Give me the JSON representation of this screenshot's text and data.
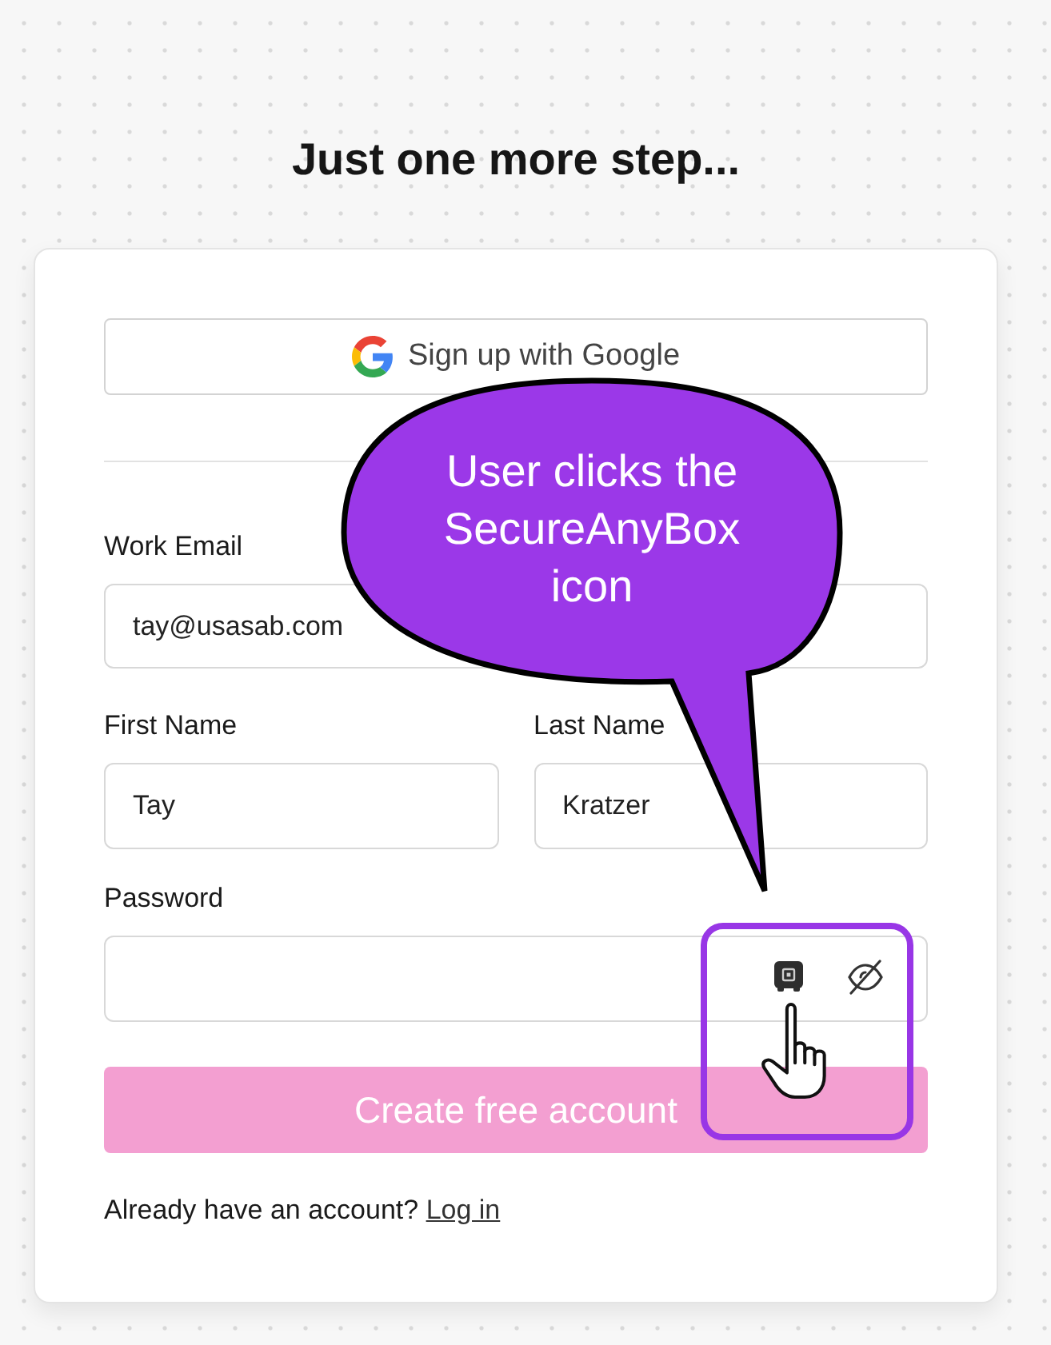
{
  "heading": "Just one more step...",
  "google_button": {
    "label": "Sign up with Google"
  },
  "work_email": {
    "label": "Work Email",
    "value": "tay@usasab.com"
  },
  "name_fields": [
    {
      "label": "First Name",
      "value": "Tay"
    },
    {
      "label": "Last Name",
      "value": "Kratzer"
    }
  ],
  "password": {
    "label": "Password"
  },
  "submit_button": {
    "label": "Create free account",
    "disabled": true
  },
  "login_prompt": {
    "text": "Already have an account?",
    "link": "Log in"
  },
  "callout": {
    "text": "User clicks the SecureAnyBox icon"
  }
}
